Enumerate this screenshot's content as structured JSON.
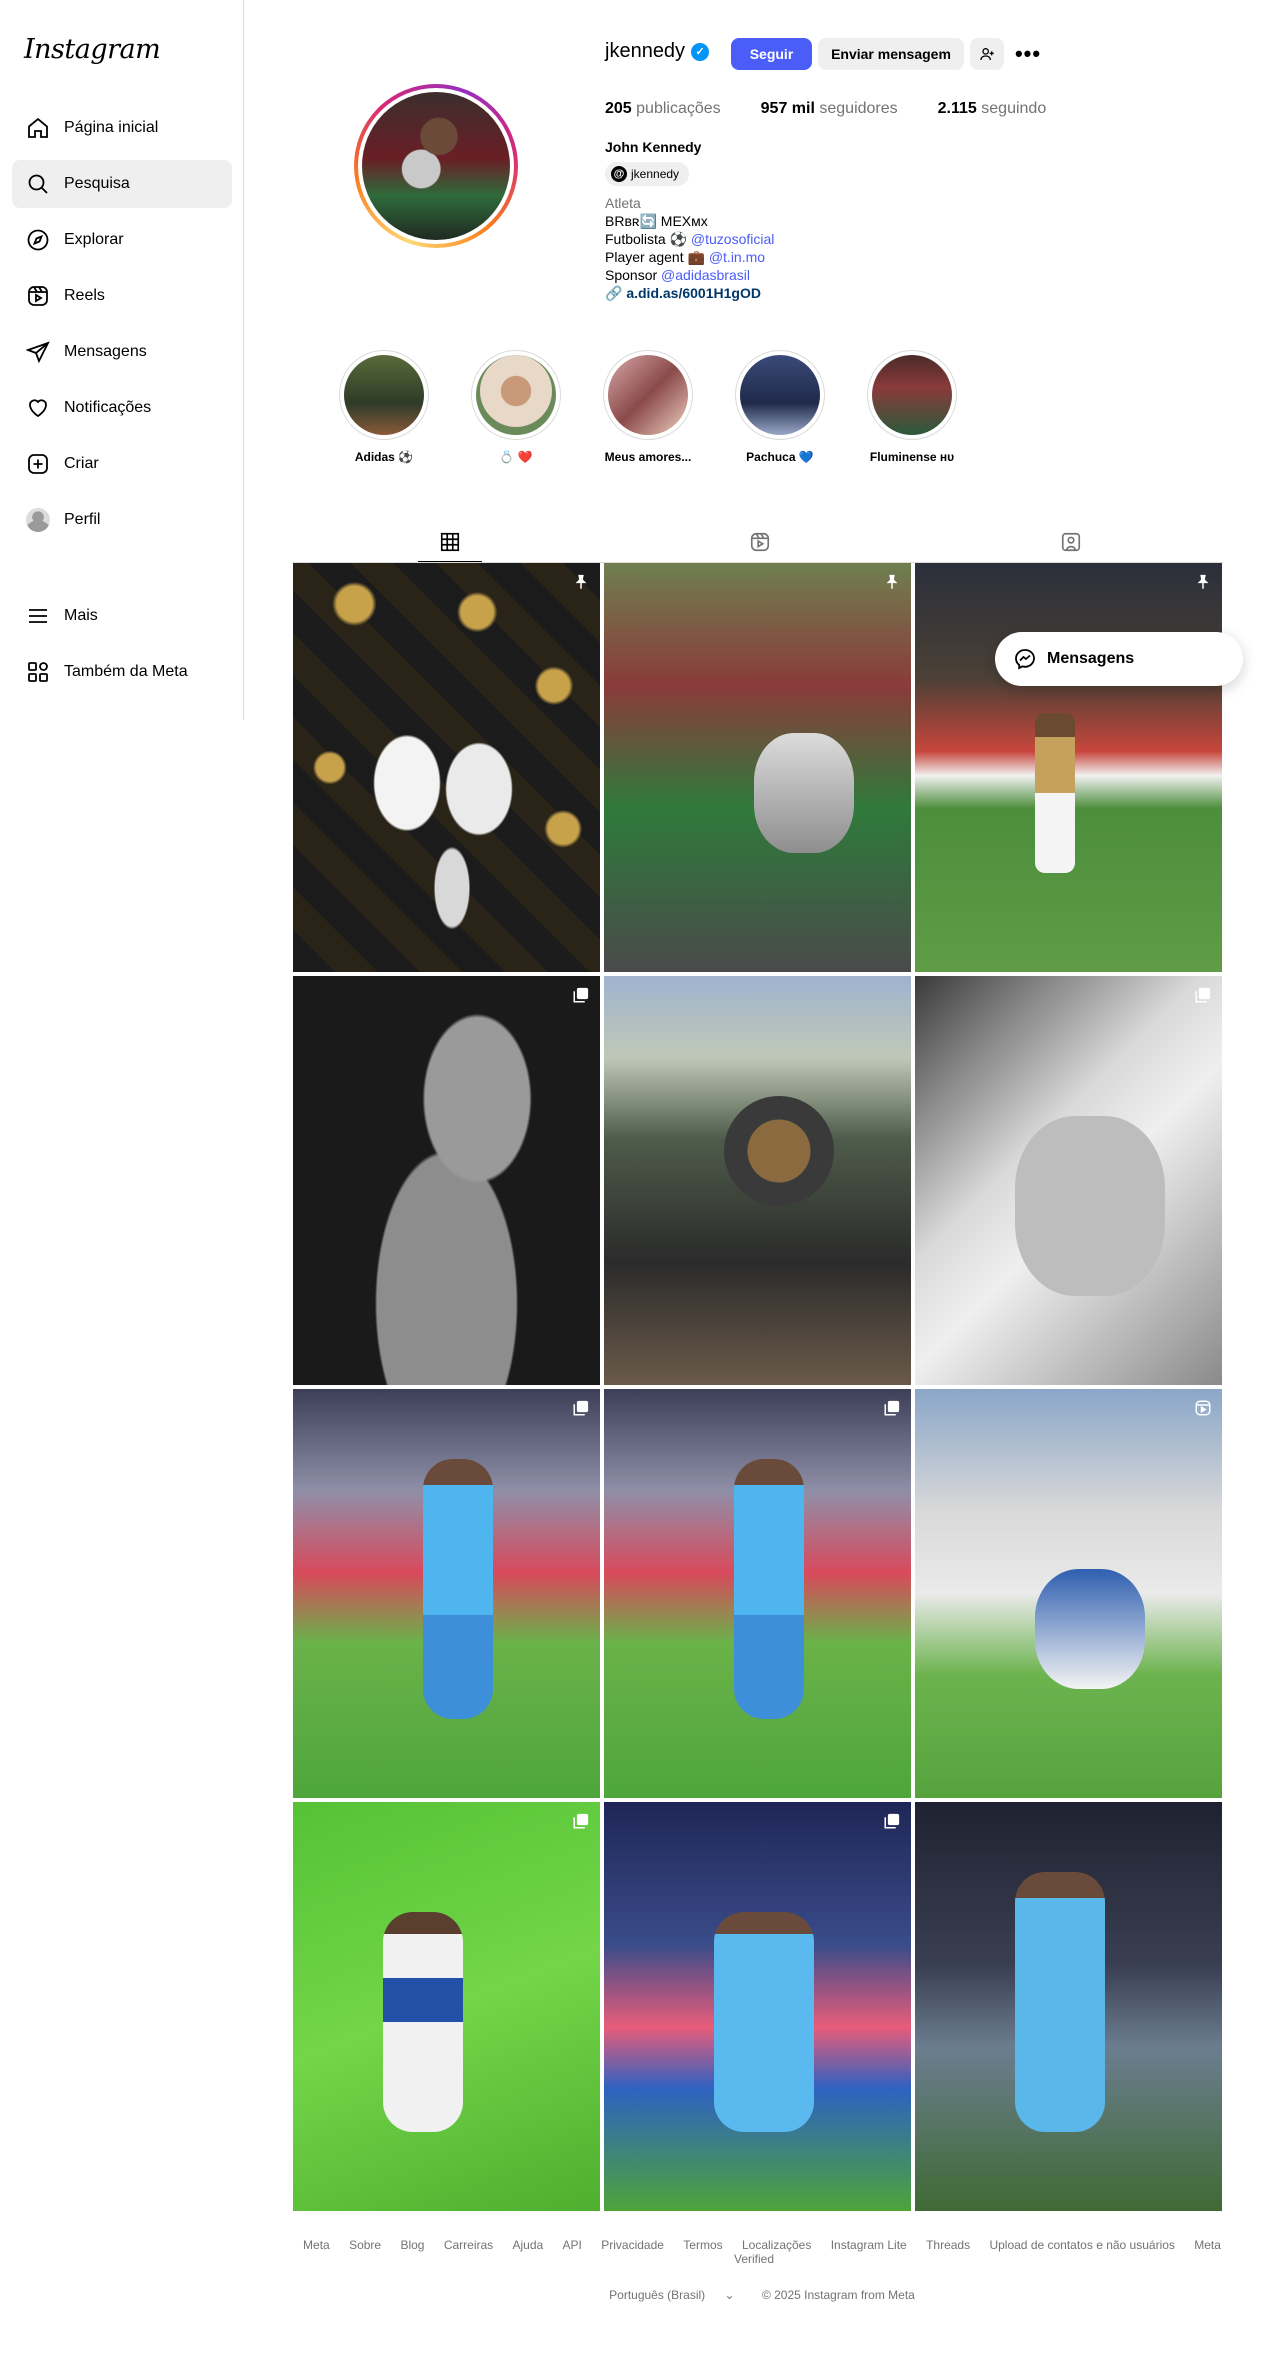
{
  "app": {
    "logo": "Instagram"
  },
  "sidebar": {
    "items": [
      {
        "label": "Página inicial",
        "icon": "home-icon"
      },
      {
        "label": "Pesquisa",
        "icon": "search-icon",
        "active": true
      },
      {
        "label": "Explorar",
        "icon": "compass-icon"
      },
      {
        "label": "Reels",
        "icon": "reels-icon"
      },
      {
        "label": "Mensagens",
        "icon": "send-icon"
      },
      {
        "label": "Notificações",
        "icon": "heart-icon"
      },
      {
        "label": "Criar",
        "icon": "plus-square-icon"
      },
      {
        "label": "Perfil",
        "icon": "avatar"
      }
    ],
    "more": "Mais",
    "meta": "Também da Meta"
  },
  "profile": {
    "username": "jkennedy",
    "verified": true,
    "follow_label": "Seguir",
    "message_label": "Enviar mensagem",
    "more_label": "•••",
    "stats": {
      "posts_count": "205",
      "posts_label": "publicações",
      "followers_count": "957 mil",
      "followers_label": "seguidores",
      "following_count": "2.115",
      "following_label": "seguindo"
    },
    "name": "John Kennedy",
    "threads_handle": "jkennedy",
    "category": "Atleta",
    "bio_line1": "BRʙʀ🔄 MEXᴍx",
    "bio_line2_prefix": "Futbolista ⚽ ",
    "bio_line2_mention": "@tuzosoficial",
    "bio_line3_prefix": "Player agent 💼 ",
    "bio_line3_mention": "@t.in.mo",
    "bio_line4_prefix": "Sponsor ",
    "bio_line4_mention": "@adidasbrasil",
    "link": "a.did.as/6001H1gOD"
  },
  "highlights": [
    {
      "label": "Adidas ⚽"
    },
    {
      "label": "💍 ❤️"
    },
    {
      "label": "Meus amores..."
    },
    {
      "label": "Pachuca 💙"
    },
    {
      "label": "Fluminense ʜᴜ"
    }
  ],
  "tabs": [
    {
      "name": "posts",
      "icon": "grid-icon",
      "active": true
    },
    {
      "name": "reels",
      "icon": "reels-icon"
    },
    {
      "name": "tagged",
      "icon": "tagged-icon"
    }
  ],
  "posts": [
    {
      "badge": "pin-icon"
    },
    {
      "badge": "pin-icon"
    },
    {
      "badge": "pin-icon"
    },
    {
      "badge": "carousel-icon"
    },
    {
      "badge": ""
    },
    {
      "badge": "carousel-icon"
    },
    {
      "badge": "carousel-icon"
    },
    {
      "badge": "carousel-icon"
    },
    {
      "badge": "reels-icon"
    },
    {
      "badge": "carousel-icon"
    },
    {
      "badge": "carousel-icon"
    },
    {
      "badge": ""
    }
  ],
  "floating_messages": {
    "label": "Mensagens"
  },
  "footer": {
    "links": [
      "Meta",
      "Sobre",
      "Blog",
      "Carreiras",
      "Ajuda",
      "API",
      "Privacidade",
      "Termos",
      "Localizações",
      "Instagram Lite",
      "Threads",
      "Upload de contatos e não usuários",
      "Meta Verified"
    ],
    "language": "Português (Brasil)",
    "copyright": "© 2025 Instagram from Meta"
  },
  "colors": {
    "accent": "#4a5df9",
    "verified": "#0095f6",
    "border": "#dbdbdb",
    "muted": "#737373"
  }
}
